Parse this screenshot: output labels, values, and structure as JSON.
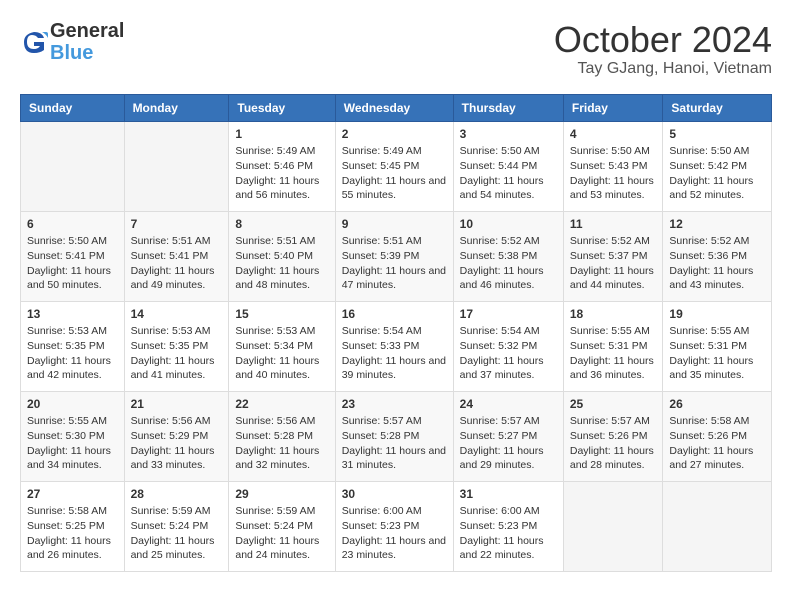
{
  "header": {
    "logo_line1": "General",
    "logo_line2": "Blue",
    "title": "October 2024",
    "subtitle": "Tay GJang, Hanoi, Vietnam"
  },
  "days_of_week": [
    "Sunday",
    "Monday",
    "Tuesday",
    "Wednesday",
    "Thursday",
    "Friday",
    "Saturday"
  ],
  "weeks": [
    [
      {
        "day": "",
        "content": ""
      },
      {
        "day": "",
        "content": ""
      },
      {
        "day": "1",
        "content": "Sunrise: 5:49 AM\nSunset: 5:46 PM\nDaylight: 11 hours and 56 minutes."
      },
      {
        "day": "2",
        "content": "Sunrise: 5:49 AM\nSunset: 5:45 PM\nDaylight: 11 hours and 55 minutes."
      },
      {
        "day": "3",
        "content": "Sunrise: 5:50 AM\nSunset: 5:44 PM\nDaylight: 11 hours and 54 minutes."
      },
      {
        "day": "4",
        "content": "Sunrise: 5:50 AM\nSunset: 5:43 PM\nDaylight: 11 hours and 53 minutes."
      },
      {
        "day": "5",
        "content": "Sunrise: 5:50 AM\nSunset: 5:42 PM\nDaylight: 11 hours and 52 minutes."
      }
    ],
    [
      {
        "day": "6",
        "content": "Sunrise: 5:50 AM\nSunset: 5:41 PM\nDaylight: 11 hours and 50 minutes."
      },
      {
        "day": "7",
        "content": "Sunrise: 5:51 AM\nSunset: 5:41 PM\nDaylight: 11 hours and 49 minutes."
      },
      {
        "day": "8",
        "content": "Sunrise: 5:51 AM\nSunset: 5:40 PM\nDaylight: 11 hours and 48 minutes."
      },
      {
        "day": "9",
        "content": "Sunrise: 5:51 AM\nSunset: 5:39 PM\nDaylight: 11 hours and 47 minutes."
      },
      {
        "day": "10",
        "content": "Sunrise: 5:52 AM\nSunset: 5:38 PM\nDaylight: 11 hours and 46 minutes."
      },
      {
        "day": "11",
        "content": "Sunrise: 5:52 AM\nSunset: 5:37 PM\nDaylight: 11 hours and 44 minutes."
      },
      {
        "day": "12",
        "content": "Sunrise: 5:52 AM\nSunset: 5:36 PM\nDaylight: 11 hours and 43 minutes."
      }
    ],
    [
      {
        "day": "13",
        "content": "Sunrise: 5:53 AM\nSunset: 5:35 PM\nDaylight: 11 hours and 42 minutes."
      },
      {
        "day": "14",
        "content": "Sunrise: 5:53 AM\nSunset: 5:35 PM\nDaylight: 11 hours and 41 minutes."
      },
      {
        "day": "15",
        "content": "Sunrise: 5:53 AM\nSunset: 5:34 PM\nDaylight: 11 hours and 40 minutes."
      },
      {
        "day": "16",
        "content": "Sunrise: 5:54 AM\nSunset: 5:33 PM\nDaylight: 11 hours and 39 minutes."
      },
      {
        "day": "17",
        "content": "Sunrise: 5:54 AM\nSunset: 5:32 PM\nDaylight: 11 hours and 37 minutes."
      },
      {
        "day": "18",
        "content": "Sunrise: 5:55 AM\nSunset: 5:31 PM\nDaylight: 11 hours and 36 minutes."
      },
      {
        "day": "19",
        "content": "Sunrise: 5:55 AM\nSunset: 5:31 PM\nDaylight: 11 hours and 35 minutes."
      }
    ],
    [
      {
        "day": "20",
        "content": "Sunrise: 5:55 AM\nSunset: 5:30 PM\nDaylight: 11 hours and 34 minutes."
      },
      {
        "day": "21",
        "content": "Sunrise: 5:56 AM\nSunset: 5:29 PM\nDaylight: 11 hours and 33 minutes."
      },
      {
        "day": "22",
        "content": "Sunrise: 5:56 AM\nSunset: 5:28 PM\nDaylight: 11 hours and 32 minutes."
      },
      {
        "day": "23",
        "content": "Sunrise: 5:57 AM\nSunset: 5:28 PM\nDaylight: 11 hours and 31 minutes."
      },
      {
        "day": "24",
        "content": "Sunrise: 5:57 AM\nSunset: 5:27 PM\nDaylight: 11 hours and 29 minutes."
      },
      {
        "day": "25",
        "content": "Sunrise: 5:57 AM\nSunset: 5:26 PM\nDaylight: 11 hours and 28 minutes."
      },
      {
        "day": "26",
        "content": "Sunrise: 5:58 AM\nSunset: 5:26 PM\nDaylight: 11 hours and 27 minutes."
      }
    ],
    [
      {
        "day": "27",
        "content": "Sunrise: 5:58 AM\nSunset: 5:25 PM\nDaylight: 11 hours and 26 minutes."
      },
      {
        "day": "28",
        "content": "Sunrise: 5:59 AM\nSunset: 5:24 PM\nDaylight: 11 hours and 25 minutes."
      },
      {
        "day": "29",
        "content": "Sunrise: 5:59 AM\nSunset: 5:24 PM\nDaylight: 11 hours and 24 minutes."
      },
      {
        "day": "30",
        "content": "Sunrise: 6:00 AM\nSunset: 5:23 PM\nDaylight: 11 hours and 23 minutes."
      },
      {
        "day": "31",
        "content": "Sunrise: 6:00 AM\nSunset: 5:23 PM\nDaylight: 11 hours and 22 minutes."
      },
      {
        "day": "",
        "content": ""
      },
      {
        "day": "",
        "content": ""
      }
    ]
  ]
}
